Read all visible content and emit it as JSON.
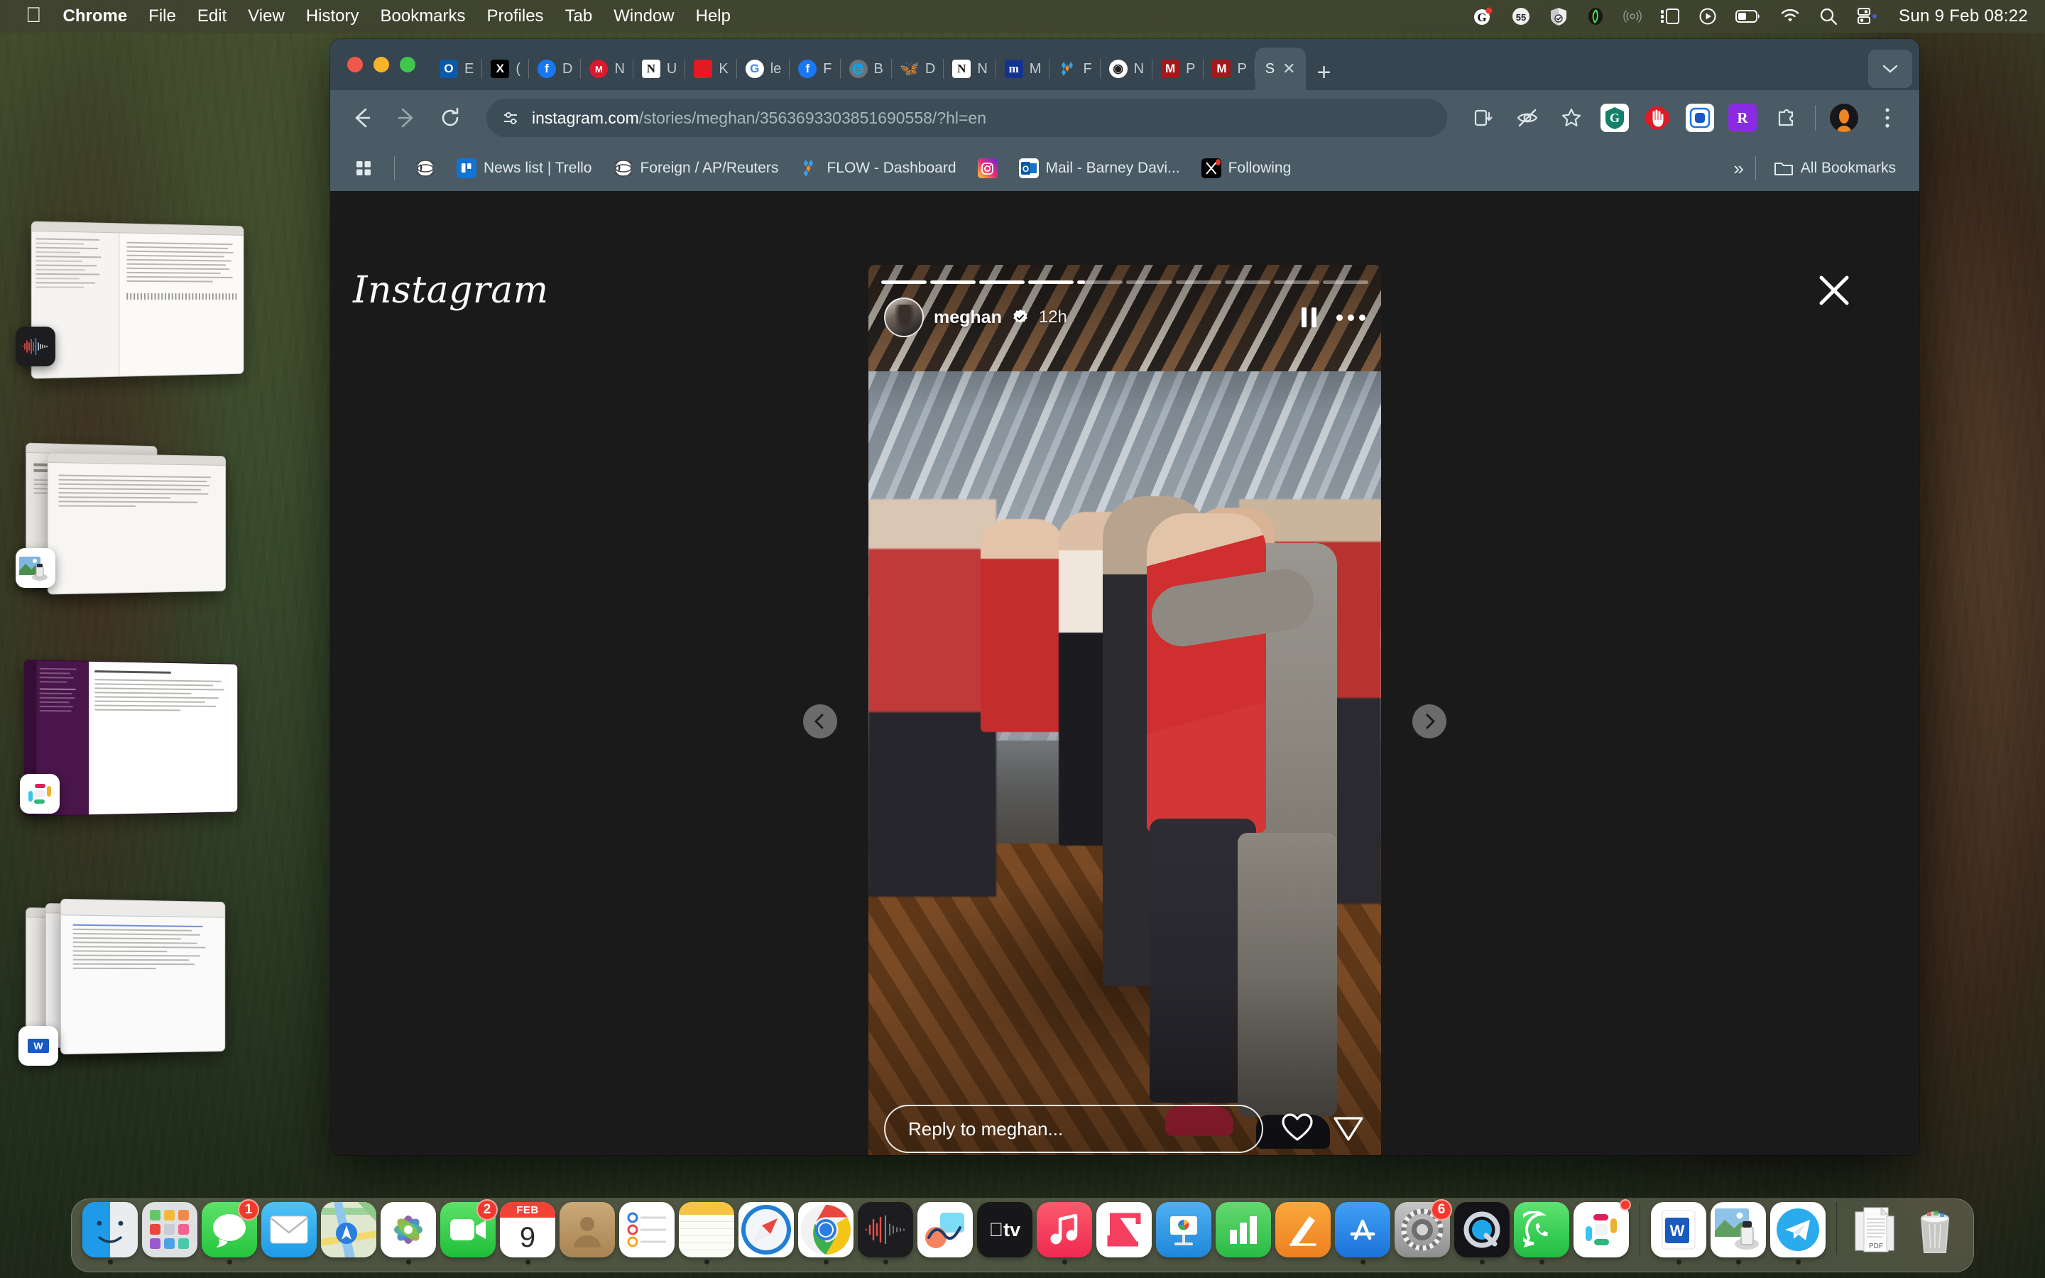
{
  "menubar": {
    "apple_icon": "apple-logo",
    "items": [
      {
        "label": "Chrome",
        "bold": true
      },
      {
        "label": "File",
        "bold": false
      },
      {
        "label": "Edit",
        "bold": false
      },
      {
        "label": "View",
        "bold": false
      },
      {
        "label": "History",
        "bold": false
      },
      {
        "label": "Bookmarks",
        "bold": false
      },
      {
        "label": "Profiles",
        "bold": false
      },
      {
        "label": "Tab",
        "bold": false
      },
      {
        "label": "Window",
        "bold": false
      },
      {
        "label": "Help",
        "bold": false
      }
    ],
    "status_icons": [
      {
        "name": "grammarly-menubar-icon",
        "glyph": "G"
      },
      {
        "name": "battery-percent-icon",
        "glyph": "55"
      },
      {
        "name": "vpn-shield-icon",
        "glyph": "shield"
      },
      {
        "name": "app-menubar-icon",
        "glyph": "leaf"
      },
      {
        "name": "airdrop-icon",
        "glyph": "airdrop"
      },
      {
        "name": "stage-manager-icon",
        "glyph": "stage"
      },
      {
        "name": "now-playing-icon",
        "glyph": "play"
      },
      {
        "name": "battery-icon",
        "glyph": "battery"
      },
      {
        "name": "wifi-icon",
        "glyph": "wifi"
      },
      {
        "name": "spotlight-search-icon",
        "glyph": "search"
      },
      {
        "name": "control-center-icon",
        "glyph": "control"
      }
    ],
    "clock": "Sun 9 Feb  08:22"
  },
  "browser": {
    "tabs": [
      {
        "favicon": "outlook-icon",
        "title": "E",
        "active": false
      },
      {
        "favicon": "x-twitter-icon",
        "title": "(",
        "active": false
      },
      {
        "favicon": "facebook-icon",
        "title": "D",
        "active": false
      },
      {
        "favicon": "mail-red-icon",
        "title": "N",
        "active": false
      },
      {
        "favicon": "newspaper-icon",
        "title": "U",
        "active": false
      },
      {
        "favicon": "keystone-icon",
        "title": "K",
        "active": false
      },
      {
        "favicon": "google-icon",
        "title": "le",
        "active": false
      },
      {
        "favicon": "facebook-icon",
        "title": "F",
        "active": false
      },
      {
        "favicon": "globe-grey-icon",
        "title": "B",
        "active": false
      },
      {
        "favicon": "bluesky-icon",
        "title": "D",
        "active": false
      },
      {
        "favicon": "newspaper-icon",
        "title": "N",
        "active": false
      },
      {
        "favicon": "medium-icon",
        "title": "M",
        "active": false
      },
      {
        "favicon": "flow-icon",
        "title": "F",
        "active": false
      },
      {
        "favicon": "chrome-alt-icon",
        "title": "N",
        "active": false
      },
      {
        "favicon": "mail-m-icon",
        "title": "P",
        "active": false
      },
      {
        "favicon": "mail-m-icon",
        "title": "P",
        "active": false
      },
      {
        "favicon": "instagram-icon",
        "title": "S",
        "active": true
      }
    ],
    "new_tab_label": "+",
    "tab_search_icon": "chevron-down-icon",
    "nav": {
      "back_icon": "arrow-left-icon",
      "forward_icon": "arrow-right-icon",
      "reload_icon": "reload-icon"
    },
    "omnibox": {
      "site_settings_icon": "tune-icon",
      "domain": "instagram.com",
      "path": "/stories/meghan/3563693303851690558/?hl=en"
    },
    "toolbar_right": [
      {
        "name": "install-app-icon",
        "glyph": "install"
      },
      {
        "name": "eye-off-icon",
        "glyph": "eyeoff"
      },
      {
        "name": "bookmark-star-icon",
        "glyph": "star"
      },
      {
        "name": "grammarly-extension-icon",
        "glyph": "G"
      },
      {
        "name": "adblock-extension-icon",
        "glyph": "hand"
      },
      {
        "name": "blue-square-extension-icon",
        "glyph": "O"
      },
      {
        "name": "rakuten-extension-icon",
        "glyph": "R"
      },
      {
        "name": "extensions-puzzle-icon",
        "glyph": "puzzle"
      },
      {
        "name": "profile-avatar-icon",
        "glyph": "avatar"
      },
      {
        "name": "chrome-menu-icon",
        "glyph": "dots"
      }
    ],
    "bookmarks": [
      {
        "name": "apps-grid-bookmark",
        "icon": "apps-grid-icon",
        "label": ""
      },
      {
        "name": "globe-bookmark",
        "icon": "globe-icon",
        "label": ""
      },
      {
        "name": "trello-bookmark",
        "icon": "trello-icon",
        "label": "News list | Trello"
      },
      {
        "name": "foreign-bookmark",
        "icon": "globe-icon",
        "label": "Foreign / AP/Reuters"
      },
      {
        "name": "flow-bookmark",
        "icon": "flow-icon",
        "label": "FLOW - Dashboard"
      },
      {
        "name": "instagram-bookmark",
        "icon": "instagram-icon",
        "label": ""
      },
      {
        "name": "mail-bookmark",
        "icon": "outlook-icon",
        "label": "Mail - Barney Davi..."
      },
      {
        "name": "following-bookmark",
        "icon": "x-twitter-icon",
        "label": "Following"
      }
    ],
    "bookmarks_overflow": "»",
    "all_bookmarks_label": "All Bookmarks",
    "all_bookmarks_icon": "folder-icon"
  },
  "instagram": {
    "logo": "Instagram",
    "close_icon": "close-icon",
    "prev_icon": "chevron-left-icon",
    "next_icon": "chevron-right-icon",
    "story": {
      "username": "meghan",
      "verified": true,
      "timestamp": "12h",
      "pause_icon": "pause-icon",
      "more_icon": "more-options-icon",
      "progress_total": 10,
      "progress_current_index": 4,
      "progress_current_percent": 16,
      "reply_placeholder": "Reply to meghan...",
      "like_icon": "heart-icon",
      "share_icon": "share-paper-plane-icon"
    }
  },
  "dock": {
    "apps": [
      {
        "name": "finder",
        "label": "Finder",
        "running": true,
        "badge": null
      },
      {
        "name": "launchpad",
        "label": "Launchpad",
        "running": false,
        "badge": null
      },
      {
        "name": "messages",
        "label": "Messages",
        "running": true,
        "badge": "1"
      },
      {
        "name": "mail",
        "label": "Mail",
        "running": false,
        "badge": null
      },
      {
        "name": "maps",
        "label": "Maps",
        "running": false,
        "badge": null
      },
      {
        "name": "photos",
        "label": "Photos",
        "running": true,
        "badge": null
      },
      {
        "name": "facetime",
        "label": "FaceTime",
        "running": false,
        "badge": "2"
      },
      {
        "name": "calendar",
        "label": "Calendar",
        "running": true,
        "badge": null,
        "month": "FEB",
        "day": "9"
      },
      {
        "name": "contacts",
        "label": "Contacts",
        "running": false,
        "badge": null
      },
      {
        "name": "reminders",
        "label": "Reminders",
        "running": false,
        "badge": null
      },
      {
        "name": "notes",
        "label": "Notes",
        "running": true,
        "badge": null
      },
      {
        "name": "safari",
        "label": "Safari",
        "running": false,
        "badge": null
      },
      {
        "name": "chrome",
        "label": "Google Chrome",
        "running": true,
        "badge": null
      },
      {
        "name": "voice-memos",
        "label": "Voice Memos",
        "running": true,
        "badge": null
      },
      {
        "name": "freeform",
        "label": "Freeform",
        "running": false,
        "badge": null
      },
      {
        "name": "apple-tv",
        "label": "Apple TV",
        "running": false,
        "badge": null
      },
      {
        "name": "music",
        "label": "Music",
        "running": true,
        "badge": null
      },
      {
        "name": "news",
        "label": "News",
        "running": false,
        "badge": null
      },
      {
        "name": "keynote",
        "label": "Keynote",
        "running": false,
        "badge": null
      },
      {
        "name": "numbers",
        "label": "Numbers",
        "running": false,
        "badge": null
      },
      {
        "name": "pages",
        "label": "Pages",
        "running": false,
        "badge": null
      },
      {
        "name": "app-store",
        "label": "App Store",
        "running": true,
        "badge": null
      },
      {
        "name": "system-settings",
        "label": "System Settings",
        "running": false,
        "badge": "6"
      },
      {
        "name": "quicktime",
        "label": "QuickTime Player",
        "running": true,
        "badge": null
      },
      {
        "name": "whatsapp",
        "label": "WhatsApp",
        "running": true,
        "badge": null
      },
      {
        "name": "slack",
        "label": "Slack",
        "running": false,
        "badge": "•"
      },
      {
        "name": "word",
        "label": "Microsoft Word",
        "running": true,
        "badge": null
      },
      {
        "name": "preview",
        "label": "Preview",
        "running": true,
        "badge": null
      },
      {
        "name": "telegram",
        "label": "Telegram",
        "running": true,
        "badge": null
      }
    ],
    "files": [
      {
        "name": "pdf-stack",
        "label": "PDF"
      },
      {
        "name": "trash",
        "label": "Trash"
      }
    ]
  },
  "stage_manager": {
    "groups": [
      {
        "name": "voice-memos-group",
        "app_icon": "voice-memos-icon"
      },
      {
        "name": "preview-group",
        "app_icon": "preview-icon"
      },
      {
        "name": "slack-group",
        "app_icon": "slack-icon"
      },
      {
        "name": "word-group",
        "app_icon": "word-icon"
      }
    ]
  }
}
